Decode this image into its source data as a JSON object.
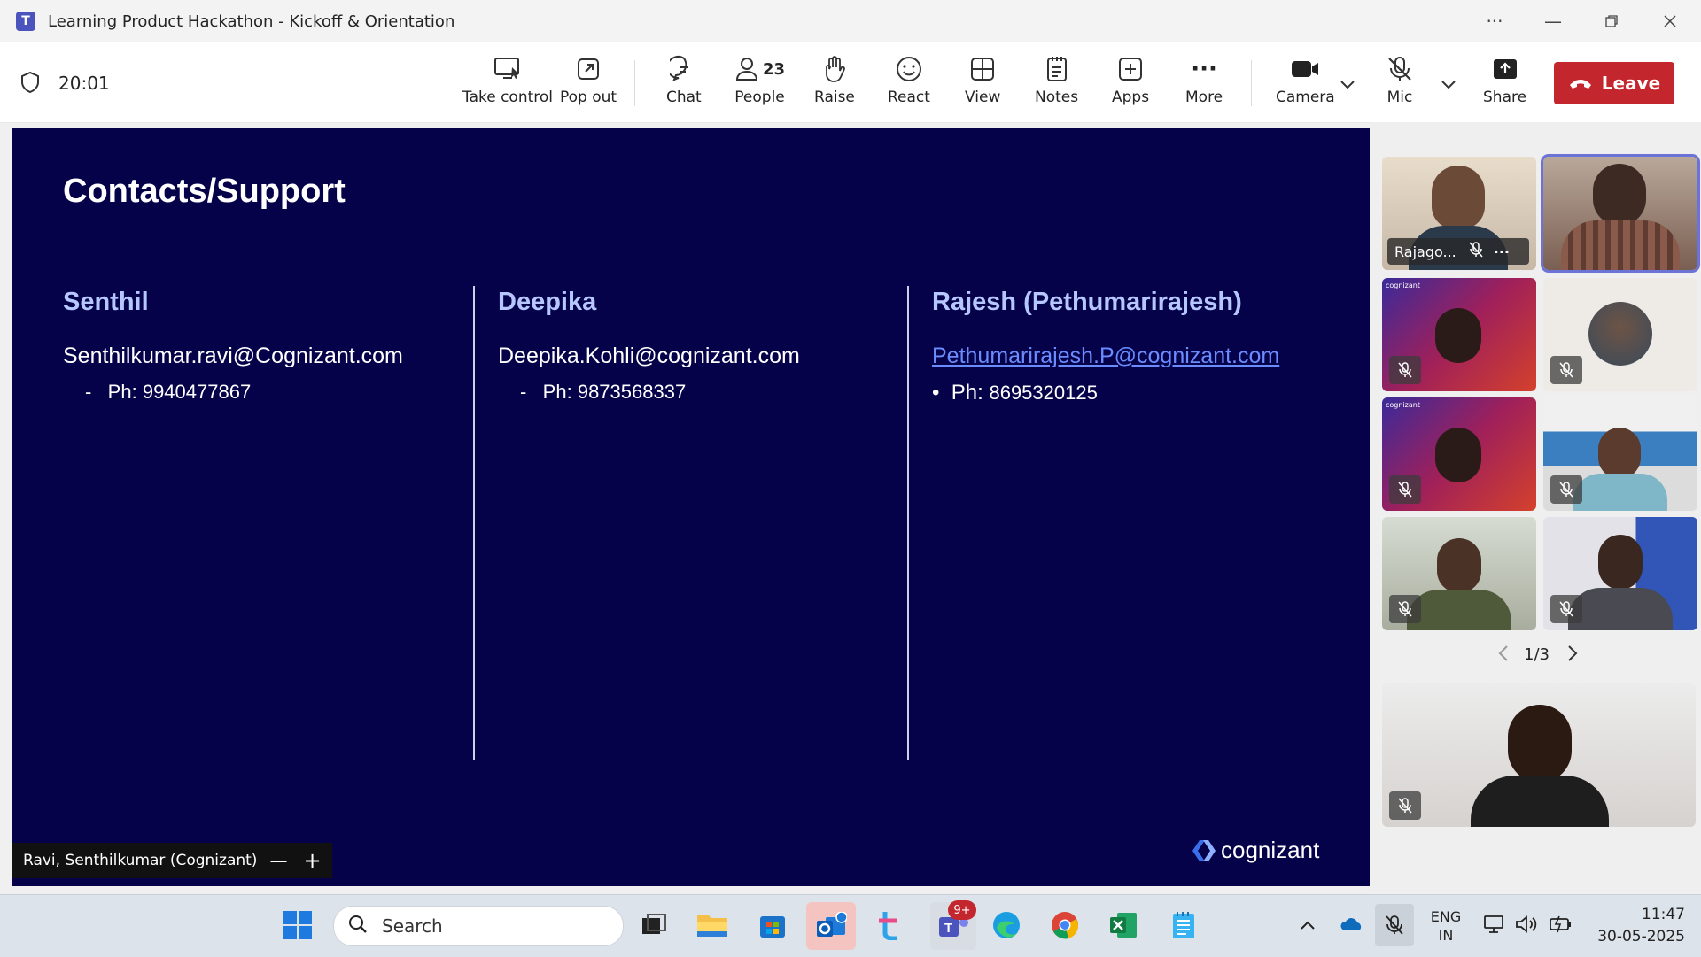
{
  "window": {
    "title": "Learning Product Hackathon - Kickoff & Orientation",
    "app_icon_letter": "T"
  },
  "meeting": {
    "timer": "20:01"
  },
  "toolbar": {
    "take_control": "Take control",
    "pop_out": "Pop out",
    "chat": "Chat",
    "people": "People",
    "people_count": "23",
    "raise": "Raise",
    "react": "React",
    "view": "View",
    "notes": "Notes",
    "apps": "Apps",
    "more": "More",
    "camera": "Camera",
    "mic": "Mic",
    "share": "Share",
    "leave": "Leave"
  },
  "slide": {
    "title": "Contacts/Support",
    "contacts": [
      {
        "name": "Senthil",
        "email": "Senthilkumar.ravi@Cognizant.com",
        "bullet": "-",
        "phone_label": "Ph:",
        "phone": "9940477867"
      },
      {
        "name": "Deepika",
        "email": "Deepika.Kohli@cognizant.com",
        "bullet": "-",
        "phone_label": "Ph:",
        "phone": "9873568337"
      },
      {
        "name": "Rajesh (Pethumarirajesh)",
        "email": "Pethumarirajesh.P@cognizant.com",
        "bullet": "•",
        "phone_label": "Ph:",
        "phone": "8695320125"
      }
    ],
    "logo_text": "cognizant",
    "presenter": "Ravi, Senthilkumar (Cognizant)"
  },
  "participants": {
    "first_name": "Rajago...",
    "tile_logo_text": "cognizant",
    "pagination": "1/3"
  },
  "taskbar": {
    "search_placeholder": "Search",
    "teams_badge": "9+",
    "lang_line1": "ENG",
    "lang_line2": "IN",
    "time": "11:47",
    "date": "30-05-2025"
  },
  "colors": {
    "slide_bg": "#05024a",
    "heading": "#b6c7ff",
    "link": "#6a8cff",
    "leave": "#c4262e",
    "teams_purple": "#4b53bc"
  }
}
